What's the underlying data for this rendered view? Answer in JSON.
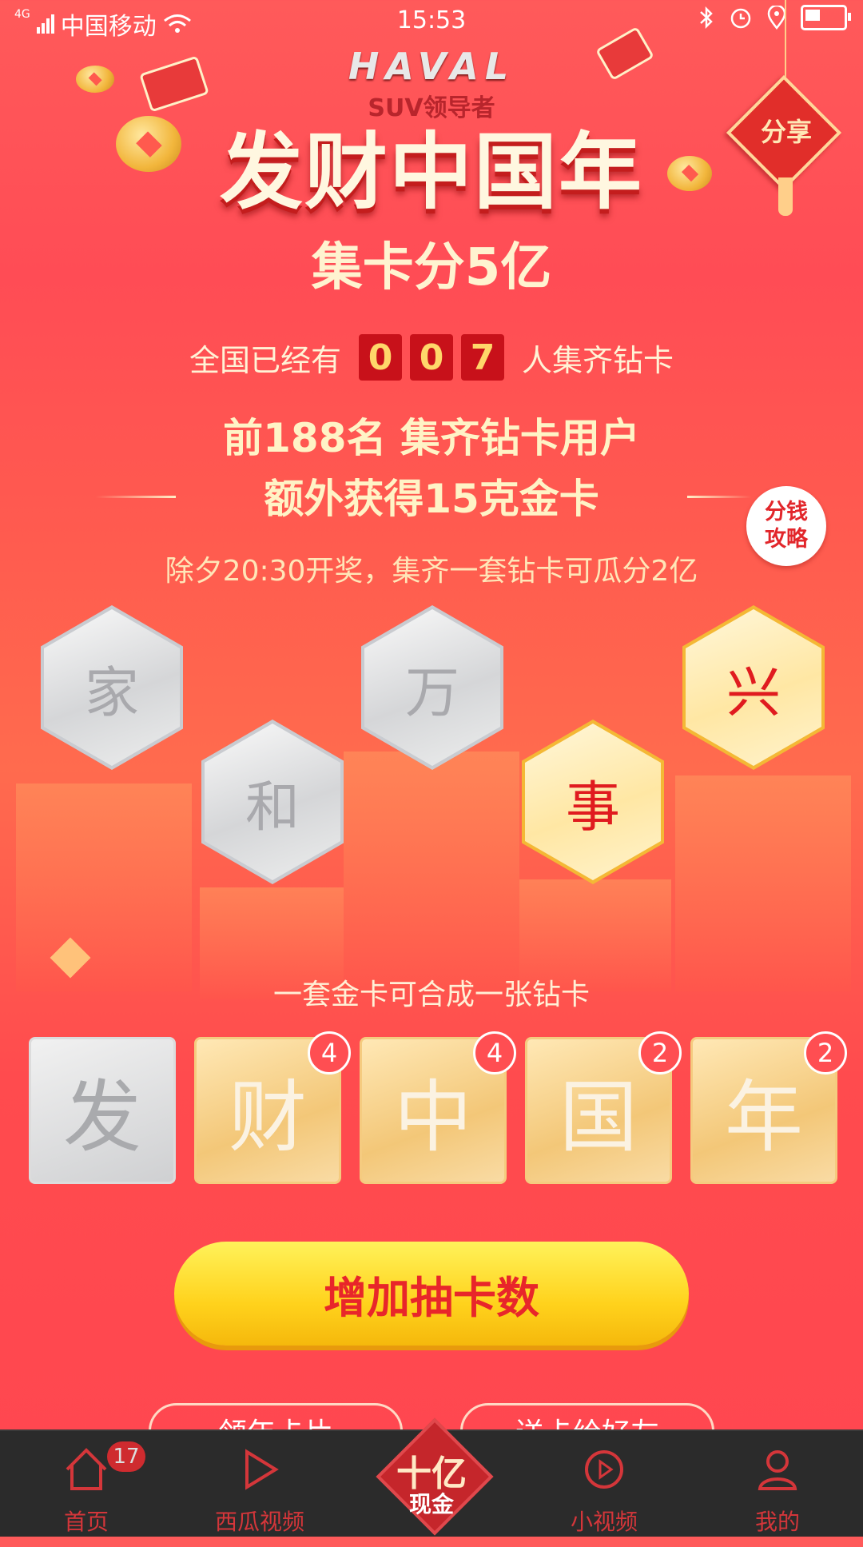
{
  "status_bar": {
    "network": "4G",
    "carrier": "中国移动",
    "time": "15:53"
  },
  "header": {
    "brand": "HAVAL",
    "brand_sub": "SUV领导者",
    "title": "发财中国年",
    "share_label": "分享"
  },
  "promo": {
    "subtitle": "集卡分5亿",
    "count_prefix": "全国已经有",
    "count_digits": [
      "0",
      "0",
      "7"
    ],
    "count_suffix": "人集齐钻卡",
    "headline1": "前188名 集齐钻卡用户",
    "headline2": "额外获得15克金卡",
    "strategy_line1": "分钱",
    "strategy_line2": "攻略",
    "note": "除夕20:30开奖，集齐一套钻卡可瓜分2亿"
  },
  "diamond_cards": [
    {
      "char": "家",
      "state": "silver"
    },
    {
      "char": "和",
      "state": "silver"
    },
    {
      "char": "万",
      "state": "silver"
    },
    {
      "char": "事",
      "state": "gold"
    },
    {
      "char": "兴",
      "state": "gold"
    }
  ],
  "gold_section": {
    "hint": "一套金卡可合成一张钻卡",
    "cards": [
      {
        "char": "发",
        "state": "silver",
        "count": ""
      },
      {
        "char": "财",
        "state": "gold",
        "count": "4"
      },
      {
        "char": "中",
        "state": "gold",
        "count": "4"
      },
      {
        "char": "国",
        "state": "gold",
        "count": "2"
      },
      {
        "char": "年",
        "state": "gold",
        "count": "2"
      }
    ]
  },
  "actions": {
    "main_button": "增加抽卡数",
    "secondary_left": "领年卡片",
    "secondary_right": "送卡给好友"
  },
  "tab_bar": {
    "home": "首页",
    "home_badge": "17",
    "xigua": "西瓜视频",
    "center_line1": "十亿",
    "center_line2": "现金",
    "small_video": "小视频",
    "mine": "我的"
  },
  "colors": {
    "background": "#ff5050",
    "accent_gold": "#ffd21c",
    "text_red": "#e8262a",
    "tab_bar": "#2b2b2b"
  }
}
